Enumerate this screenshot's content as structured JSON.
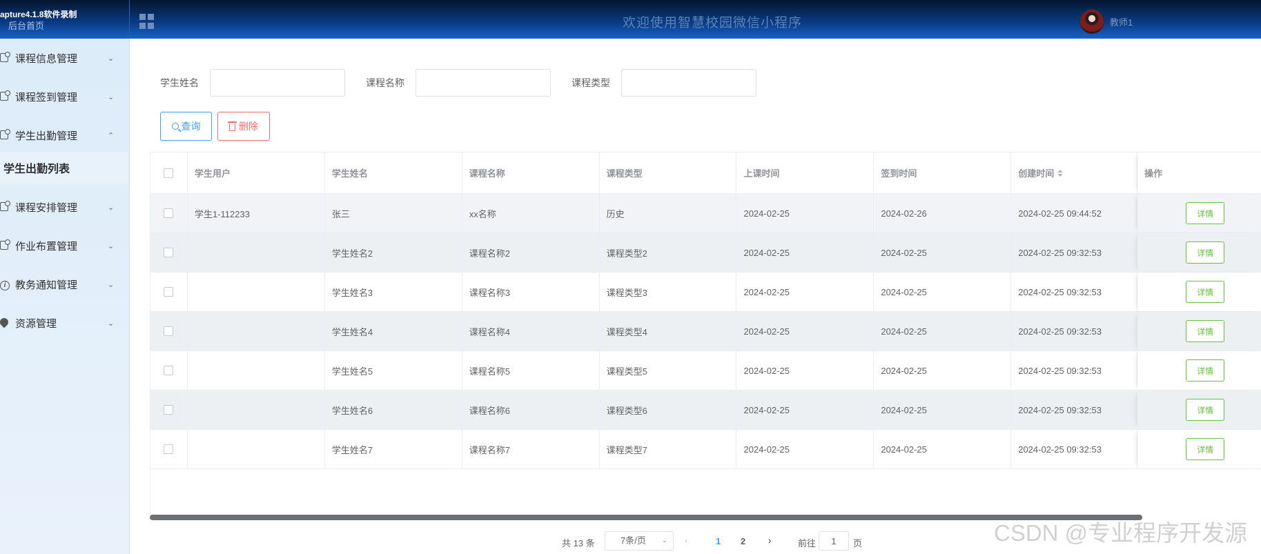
{
  "header": {
    "watermark_text": "apture4.1.8软件录制",
    "home_label": "后台首页",
    "site_title": "欢迎使用智慧校园微信小程序",
    "user_name": "教师1"
  },
  "sidebar": {
    "items": [
      {
        "label": "课程信息管理",
        "icon": "doc-icon",
        "chevron": "chevron-down"
      },
      {
        "label": "课程签到管理",
        "icon": "doc-icon",
        "chevron": "chevron-down"
      },
      {
        "label": "学生出勤管理",
        "icon": "doc-icon",
        "chevron": "chevron-up"
      },
      {
        "label": "课程安排管理",
        "icon": "doc-icon",
        "chevron": "chevron-down"
      },
      {
        "label": "作业布置管理",
        "icon": "doc-icon",
        "chevron": "chevron-down"
      },
      {
        "label": "教务通知管理",
        "icon": "info-icon",
        "chevron": "chevron-down"
      },
      {
        "label": "资源管理",
        "icon": "drop-icon",
        "chevron": "chevron-down"
      }
    ],
    "active_submenu": "学生出勤列表"
  },
  "search": {
    "fields": [
      {
        "label": "学生姓名",
        "value": "",
        "placeholder": ""
      },
      {
        "label": "课程名称",
        "value": "",
        "placeholder": ""
      },
      {
        "label": "课程类型",
        "value": "",
        "placeholder": ""
      }
    ],
    "search_button": "查询",
    "delete_button": "删除"
  },
  "table": {
    "columns": [
      "学生用户",
      "学生姓名",
      "课程名称",
      "课程类型",
      "上课时间",
      "签到时间",
      "创建时间",
      "操作"
    ],
    "detail_label": "详情",
    "rows": [
      {
        "user": "学生1-112233",
        "name": "张三",
        "course": "xx名称",
        "type": "历史",
        "class_time": "2024-02-25",
        "sign_time": "2024-02-26",
        "created": "2024-02-25 09:44:52"
      },
      {
        "user": "",
        "name": "学生姓名2",
        "course": "课程名称2",
        "type": "课程类型2",
        "class_time": "2024-02-25",
        "sign_time": "2024-02-25",
        "created": "2024-02-25 09:32:53"
      },
      {
        "user": "",
        "name": "学生姓名3",
        "course": "课程名称3",
        "type": "课程类型3",
        "class_time": "2024-02-25",
        "sign_time": "2024-02-25",
        "created": "2024-02-25 09:32:53"
      },
      {
        "user": "",
        "name": "学生姓名4",
        "course": "课程名称4",
        "type": "课程类型4",
        "class_time": "2024-02-25",
        "sign_time": "2024-02-25",
        "created": "2024-02-25 09:32:53"
      },
      {
        "user": "",
        "name": "学生姓名5",
        "course": "课程名称5",
        "type": "课程类型5",
        "class_time": "2024-02-25",
        "sign_time": "2024-02-25",
        "created": "2024-02-25 09:32:53"
      },
      {
        "user": "",
        "name": "学生姓名6",
        "course": "课程名称6",
        "type": "课程类型6",
        "class_time": "2024-02-25",
        "sign_time": "2024-02-25",
        "created": "2024-02-25 09:32:53"
      },
      {
        "user": "",
        "name": "学生姓名7",
        "course": "课程名称7",
        "type": "课程类型7",
        "class_time": "2024-02-25",
        "sign_time": "2024-02-25",
        "created": "2024-02-25 09:32:53"
      }
    ]
  },
  "pagination": {
    "total_text": "共 13 条",
    "page_size": "7条/页",
    "pages": [
      "1",
      "2"
    ],
    "current_page": "1",
    "goto_label": "前往",
    "goto_value": "1",
    "page_suffix": "页"
  },
  "watermark": "CSDN @专业程序开发源",
  "colors": {
    "header_dark": "#04152f",
    "header_blue": "#1662c8",
    "sidebar_bg": "#dcecf9",
    "primary": "#409eff",
    "danger": "#f56c6c",
    "success": "#67c23a"
  }
}
